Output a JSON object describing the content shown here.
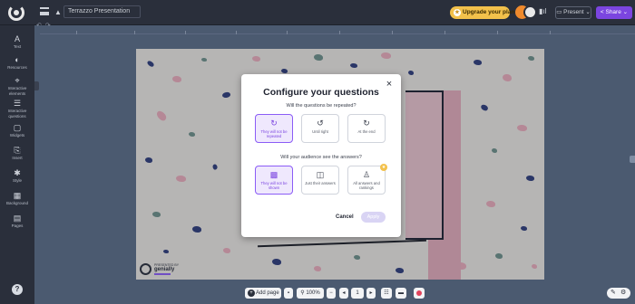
{
  "header": {
    "menu_icon": "hamburger-icon",
    "project_icon": "presentation-icon",
    "title_value": "Terrazzo Presentation",
    "upgrade_label": "Upgrade your plan",
    "present_label": "Present",
    "share_label": "Share"
  },
  "sidebar": {
    "items": [
      {
        "label": "Text",
        "icon": "A"
      },
      {
        "label": "Resources",
        "icon": "◐"
      },
      {
        "label": "Interactive elements",
        "icon": "⌖"
      },
      {
        "label": "Interactive questions",
        "icon": "☰"
      },
      {
        "label": "Widgets",
        "icon": "▢"
      },
      {
        "label": "Insert",
        "icon": "⎘"
      },
      {
        "label": "Style",
        "icon": "✱"
      },
      {
        "label": "Background",
        "icon": "▦"
      },
      {
        "label": "Pages",
        "icon": "▤"
      }
    ],
    "help_label": "?"
  },
  "canvas": {
    "logo_small": "PRESENTED BY",
    "logo_text": "genially"
  },
  "modal": {
    "title": "Configure your questions",
    "close_label": "×",
    "question1": "Will the questions be repeated?",
    "options1": [
      {
        "label": "They will not be repeated",
        "icon": "↻",
        "selected": true
      },
      {
        "label": "Until right",
        "icon": "↺",
        "selected": false
      },
      {
        "label": "At the end",
        "icon": "↻",
        "selected": false
      }
    ],
    "question2": "Will your audience see the answers?",
    "options2": [
      {
        "label": "They will not be shown",
        "icon": "▩",
        "selected": true
      },
      {
        "label": "Just their answers",
        "icon": "◫",
        "selected": false
      },
      {
        "label": "All answers and rankings",
        "icon": "♙",
        "selected": false,
        "premium": true
      }
    ],
    "cancel_label": "Cancel",
    "apply_label": "Apply"
  },
  "bottombar": {
    "add_page_label": "Add page",
    "delete_icon": "trash-icon",
    "zoom_value": "100%",
    "page_value": "1",
    "zoom_out_label": "−",
    "prev_label": "◂",
    "next_label": "▸"
  },
  "colors": {
    "accent": "#7b45e0",
    "upgrade": "#f3c14b",
    "topbar": "#2a2f3b",
    "workspace": "#4b5a70"
  }
}
